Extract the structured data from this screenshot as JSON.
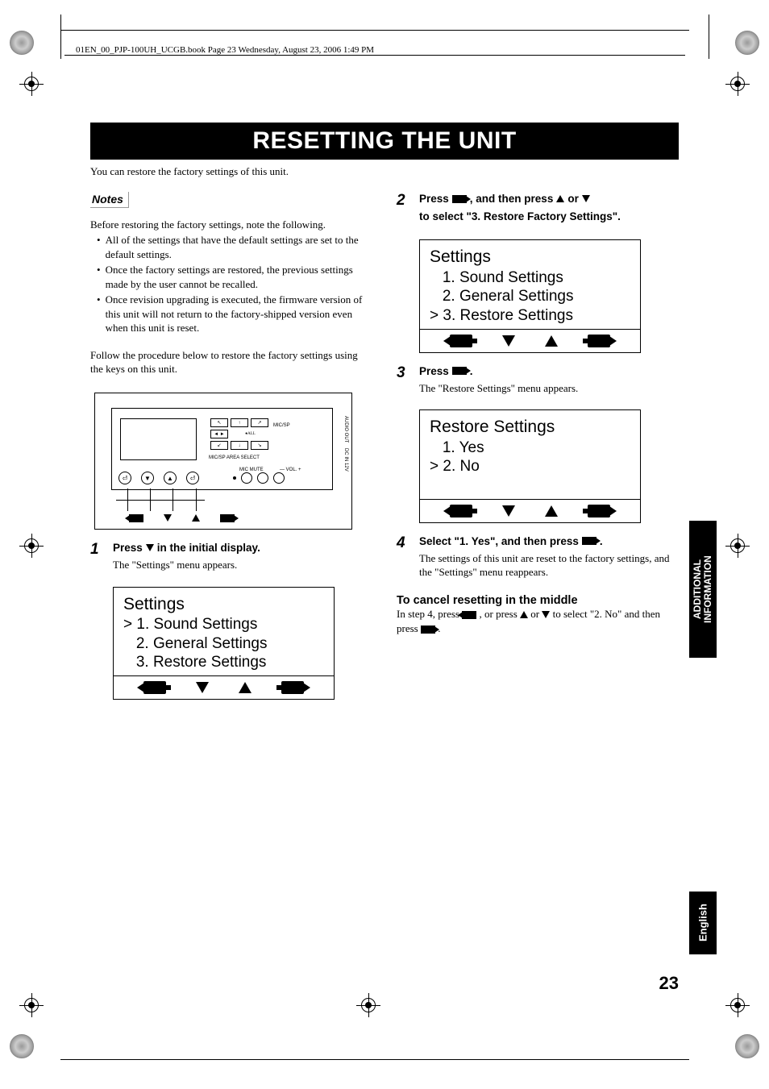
{
  "header": "01EN_00_PJP-100UH_UCGB.book  Page 23  Wednesday, August 23, 2006  1:49 PM",
  "title": "RESETTING THE UNIT",
  "intro": "You can restore the factory settings of this unit.",
  "notes_label": "Notes",
  "notes_intro": "Before restoring the factory settings, note the following.",
  "notes": [
    "All of the settings that have the default settings are set to the default settings.",
    "Once the factory settings are restored, the previous settings made by the user cannot be recalled.",
    "Once revision upgrading is executed, the firmware version of this unit will not return to the factory-shipped version even when this unit is reset."
  ],
  "follow_text": "Follow the procedure below to restore the factory settings using the keys on this unit.",
  "diagram": {
    "mic_sp": "MIC/SP",
    "all": "ALL",
    "area_select": "MIC/SP AREA SELECT",
    "mic_mute": "MIC MUTE",
    "vol": "VOL.",
    "audio_out": "AUDIO OUT",
    "dc": "DC IN 12V"
  },
  "step1": {
    "num": "1",
    "title_a": "Press ",
    "title_b": " in the initial display.",
    "desc": "The \"Settings\" menu appears."
  },
  "lcd1": {
    "title": "Settings",
    "l1": "> 1. Sound Settings",
    "l2": "   2. General Settings",
    "l3": "   3. Restore Settings"
  },
  "step2": {
    "num": "2",
    "title_a": "Press ",
    "title_b": ", and then press ",
    "title_c": " or ",
    "title_d": " to select \"3. Restore Factory Settings\"."
  },
  "lcd2": {
    "title": "Settings",
    "l1": "   1. Sound Settings",
    "l2": "   2. General Settings",
    "l3": "> 3. Restore Settings"
  },
  "step3": {
    "num": "3",
    "title_a": "Press ",
    "title_b": ".",
    "desc": "The \"Restore Settings\" menu appears."
  },
  "lcd3": {
    "title": "Restore Settings",
    "l1": "   1. Yes",
    "l2": "> 2. No"
  },
  "step4": {
    "num": "4",
    "title_a": "Select \"1. Yes\", and then press ",
    "title_b": ".",
    "desc": "The settings of this unit are reset to the factory settings, and the \"Settings\" menu reappears."
  },
  "cancel_heading": "To cancel resetting in the middle",
  "cancel_a": "In step 4, press ",
  "cancel_b": " , or press ",
  "cancel_c": " or ",
  "cancel_d": " to select \"2. No\" and then press ",
  "cancel_e": " .",
  "side_tab_1a": "ADDITIONAL",
  "side_tab_1b": "INFORMATION",
  "side_tab_2": "English",
  "page_num": "23"
}
